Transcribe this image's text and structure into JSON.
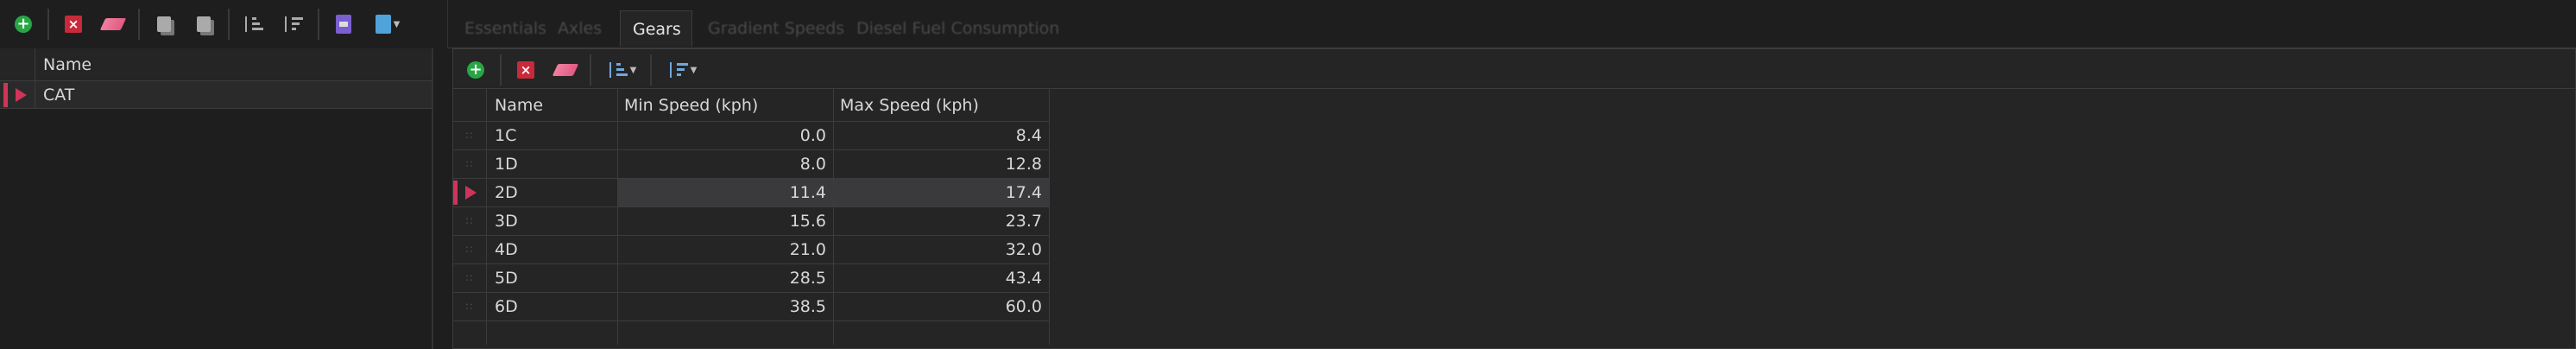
{
  "left_panel": {
    "column_header": "Name",
    "rows": [
      {
        "name": "CAT",
        "selected": true
      }
    ]
  },
  "tabs": [
    {
      "label": "Essentials",
      "active": false
    },
    {
      "label": "Axles",
      "active": false
    },
    {
      "label": "Gears",
      "active": true
    },
    {
      "label": "Gradient Speeds",
      "active": false
    },
    {
      "label": "Diesel Fuel Consumption",
      "active": false
    }
  ],
  "gears_table": {
    "columns": [
      "Name",
      "Min Speed (kph)",
      "Max Speed (kph)"
    ],
    "rows": [
      {
        "name": "1C",
        "min": "0.0",
        "max": "8.4"
      },
      {
        "name": "1D",
        "min": "8.0",
        "max": "12.8"
      },
      {
        "name": "2D",
        "min": "11.4",
        "max": "17.4",
        "selected": true
      },
      {
        "name": "3D",
        "min": "15.6",
        "max": "23.7"
      },
      {
        "name": "4D",
        "min": "21.0",
        "max": "32.0"
      },
      {
        "name": "5D",
        "min": "28.5",
        "max": "43.4"
      },
      {
        "name": "6D",
        "min": "38.5",
        "max": "60.0"
      }
    ]
  },
  "colors": {
    "accent_marker": "#d0345a",
    "add_green": "#27a643",
    "delete_red": "#c82a3a",
    "selected_row_bg": "#3a3a3c"
  },
  "icons": {
    "left_toolbar": [
      "add-icon",
      "delete-icon",
      "eraser-icon",
      "copy-icon",
      "paste-icon",
      "sort-ascending-icon",
      "sort-descending-icon",
      "import-icon",
      "export-icon"
    ],
    "right_toolbar": [
      "add-icon",
      "delete-icon",
      "eraser-icon",
      "sort-ascending-icon",
      "sort-descending-icon"
    ]
  }
}
